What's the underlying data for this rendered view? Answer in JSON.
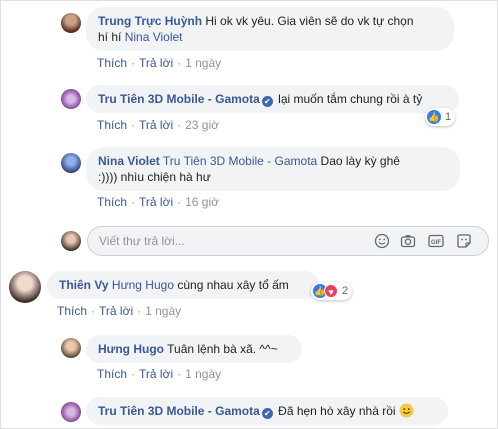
{
  "comments": [
    {
      "author": "Trung Trực Huỳnh",
      "text": "Hi ok vk yêu. Gia viên sẽ do vk tự chọn",
      "text2_prefix": "hí hí ",
      "tag": "Nina Violet",
      "like": "Thích",
      "reply": "Trả lời",
      "time": "1 ngày"
    },
    {
      "author": "Tru Tiên 3D Mobile - Gamota",
      "verified": "✔",
      "text": "lại muốn tắm chung rồi à tỷ",
      "reaction_count": "1",
      "like": "Thích",
      "reply": "Trả lời",
      "time": "23 giờ"
    },
    {
      "author": "Nina Violet",
      "tag": "Tru Tiên 3D Mobile - Gamota",
      "text": "Dao lày kỳ ghê",
      "text2": ":)))) nhìu chiện hà hư",
      "like": "Thích",
      "reply": "Trả lời",
      "time": "16 giờ"
    },
    {
      "author": "Thiên Vy",
      "tag": "Hưng Hugo",
      "text": "cùng nhau xây tổ ấm",
      "reaction_count": "2",
      "like": "Thích",
      "reply": "Trả lời",
      "time": "1 ngày"
    },
    {
      "author": "Hưng Hugo",
      "text": "Tuân lệnh bà xã. ^^~",
      "like": "Thích",
      "reply": "Trả lời",
      "time": "1 ngày"
    },
    {
      "author": "Tru Tiên 3D Mobile - Gamota",
      "verified": "✔",
      "text": "Đã hẹn hò xây nhà rồi"
    }
  ],
  "reply_box": {
    "placeholder": "Viết thư trả lời..."
  },
  "colors": {
    "link": "#385898",
    "bubble": "#f2f3f5",
    "meta": "#90949c",
    "like": "#2f7cf6",
    "love": "#f33e58"
  },
  "icons": [
    "emoji-icon",
    "camera-icon",
    "gif-icon",
    "sticker-icon",
    "like-reaction-icon",
    "love-reaction-icon",
    "smile-emoji-icon"
  ]
}
